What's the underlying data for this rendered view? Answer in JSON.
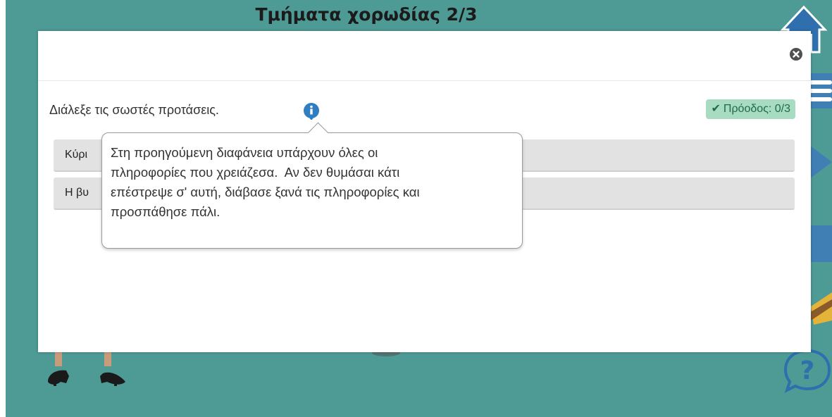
{
  "slide": {
    "title": "Τμήματα χορωδίας 2/3"
  },
  "dialog": {
    "question": "Διάλεξε τις σωστές προτάσεις.",
    "progress_icon": "check-icon",
    "progress_label": "Πρόοδος: 0/3",
    "close_icon": "close-icon",
    "info_icon": "info-icon",
    "options": [
      {
        "label": "Κύρι"
      },
      {
        "label": "Η βυ"
      }
    ],
    "tooltip": {
      "lines": [
        "Στη προηγούμενη διαφάνεια υπάρχουν όλες οι",
        "πληροφορίες που χρειάζεσα.  Αν δεν θυμάσαι κάτι",
        "επέστρεψε σ' αυτή, διάβασε ξανά τις πληροφορίες και",
        "προσπάθησε πάλι."
      ]
    }
  },
  "nav": {
    "home_icon": "home-icon",
    "menu_icon": "menu-icon",
    "next_icon": "next-arrow-icon",
    "book_icon": "book-icon",
    "help_icon": "help-icon"
  },
  "colors": {
    "stage_background": "#4e9a95",
    "progress_badge": "#a8dcc2",
    "info_blue": "#2f7ec2"
  }
}
